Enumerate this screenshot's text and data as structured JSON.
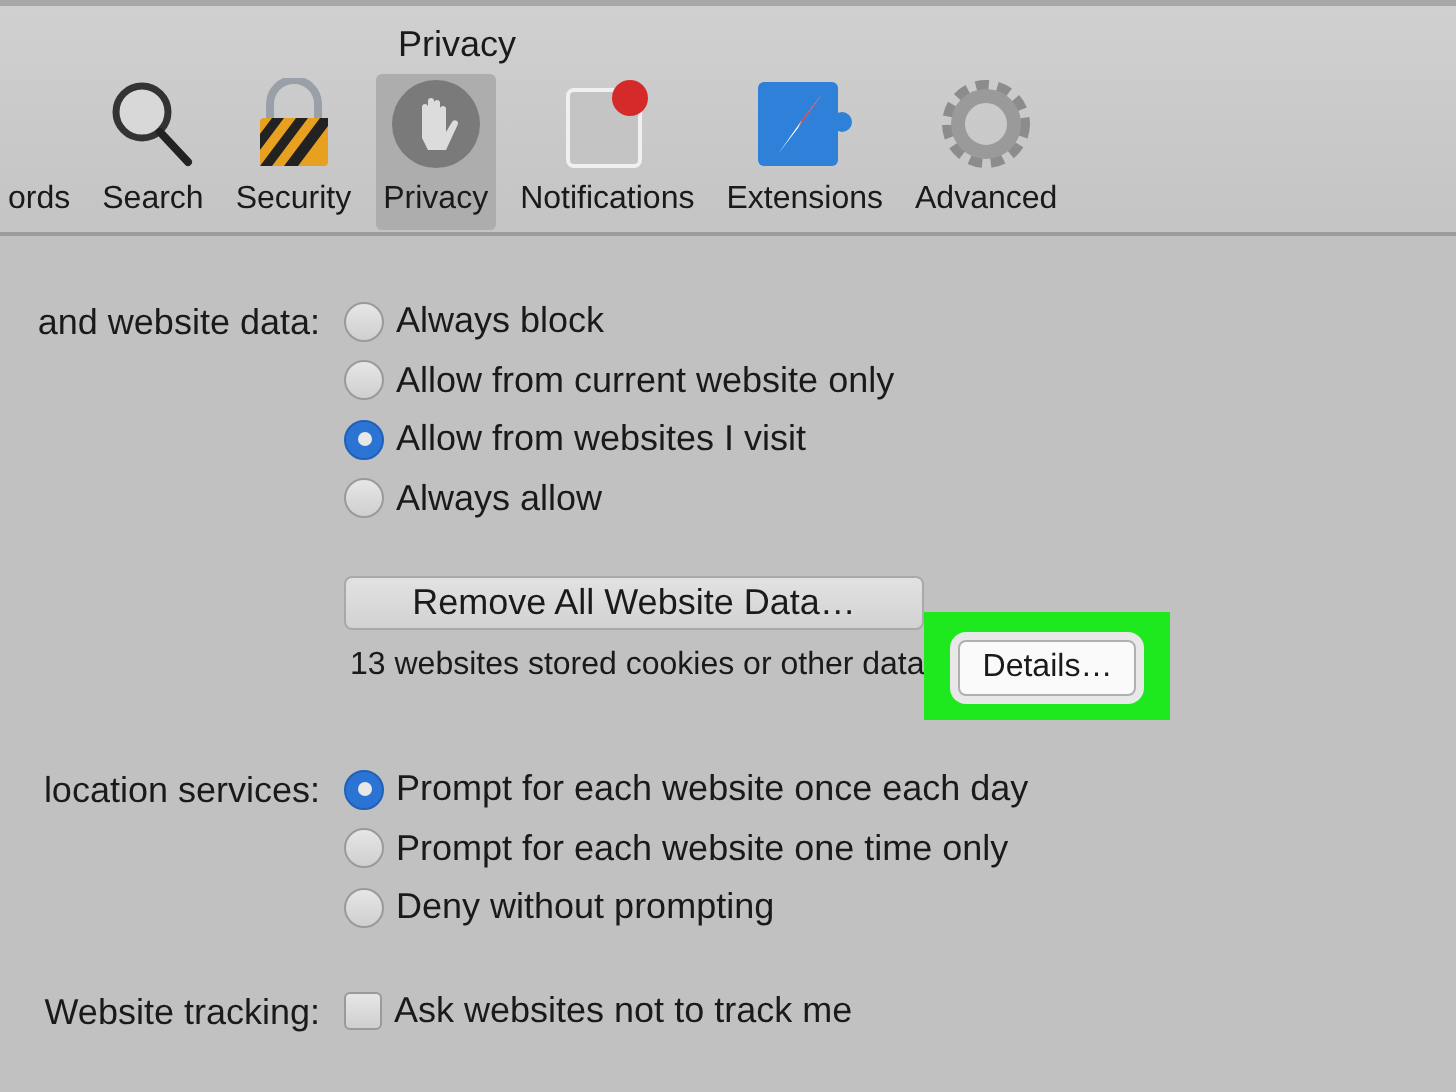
{
  "window": {
    "title": "Privacy"
  },
  "toolbar": [
    {
      "label": "ords",
      "kind": "none",
      "selected": false
    },
    {
      "label": "Search",
      "kind": "search",
      "selected": false
    },
    {
      "label": "Security",
      "kind": "lock",
      "selected": false
    },
    {
      "label": "Privacy",
      "kind": "hand",
      "selected": true
    },
    {
      "label": "Notifications",
      "kind": "notification",
      "selected": false
    },
    {
      "label": "Extensions",
      "kind": "compass",
      "selected": false
    },
    {
      "label": "Advanced",
      "kind": "gear",
      "selected": false
    }
  ],
  "cookies": {
    "label": "and website data:",
    "options": [
      {
        "label": "Always block",
        "selected": false
      },
      {
        "label": "Allow from current website only",
        "selected": false
      },
      {
        "label": "Allow from websites I visit",
        "selected": true
      },
      {
        "label": "Always allow",
        "selected": false
      }
    ],
    "remove_button": "Remove All Website Data…",
    "info": "13 websites stored cookies or other data",
    "details_button": "Details…",
    "details_highlighted": true
  },
  "location": {
    "label": "location services:",
    "options": [
      {
        "label": "Prompt for each website once each day",
        "selected": true
      },
      {
        "label": "Prompt for each website one time only",
        "selected": false
      },
      {
        "label": "Deny without prompting",
        "selected": false
      }
    ]
  },
  "tracking": {
    "label": "Website tracking:",
    "option": {
      "label": "Ask websites not to track me",
      "checked": false
    }
  }
}
